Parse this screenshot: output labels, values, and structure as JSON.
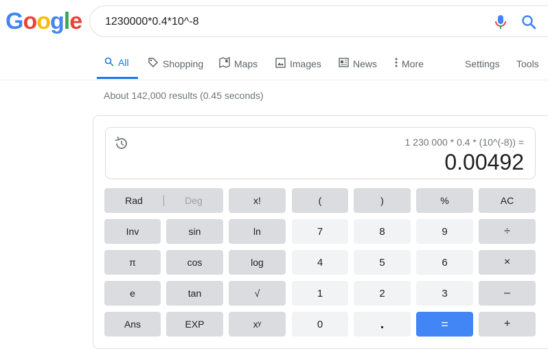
{
  "logo": {
    "text": "Google",
    "letters": [
      {
        "ch": "G",
        "color": "#4285f4"
      },
      {
        "ch": "o",
        "color": "#ea4335"
      },
      {
        "ch": "o",
        "color": "#fbbc05"
      },
      {
        "ch": "g",
        "color": "#4285f4"
      },
      {
        "ch": "l",
        "color": "#34a853"
      },
      {
        "ch": "e",
        "color": "#ea4335"
      }
    ]
  },
  "search": {
    "query": "1230000*0.4*10^-8"
  },
  "tabs": [
    {
      "label": "All",
      "icon": "search-icon",
      "active": true
    },
    {
      "label": "Shopping",
      "icon": "tag-icon"
    },
    {
      "label": "Maps",
      "icon": "map-icon"
    },
    {
      "label": "Images",
      "icon": "image-icon"
    },
    {
      "label": "News",
      "icon": "news-icon"
    },
    {
      "label": "More",
      "icon": "more-vert-icon"
    },
    {
      "label": "Settings"
    },
    {
      "label": "Tools"
    }
  ],
  "stats": "About 142,000 results (0.45 seconds)",
  "calculator": {
    "expression": "1 230 000 * 0.4 * (10^(-8)) =",
    "result": "0.00492",
    "mode": {
      "rad": "Rad",
      "deg": "Deg",
      "active": "Rad"
    },
    "keys": {
      "fact": "x!",
      "lparen": "(",
      "rparen": ")",
      "percent": "%",
      "ac": "AC",
      "inv": "Inv",
      "sin": "sin",
      "ln": "ln",
      "k7": "7",
      "k8": "8",
      "k9": "9",
      "div": "÷",
      "pi": "π",
      "cos": "cos",
      "log": "log",
      "k4": "4",
      "k5": "5",
      "k6": "6",
      "mul": "×",
      "e": "e",
      "tan": "tan",
      "sqrt": "√",
      "k1": "1",
      "k2": "2",
      "k3": "3",
      "sub": "–",
      "ans": "Ans",
      "exp": "EXP",
      "pow": "xʸ",
      "k0": "0",
      "dot": ".",
      "eq": "=",
      "add": "+"
    }
  },
  "colors": {
    "accent": "#1a73e8",
    "equals": "#4285f4"
  }
}
